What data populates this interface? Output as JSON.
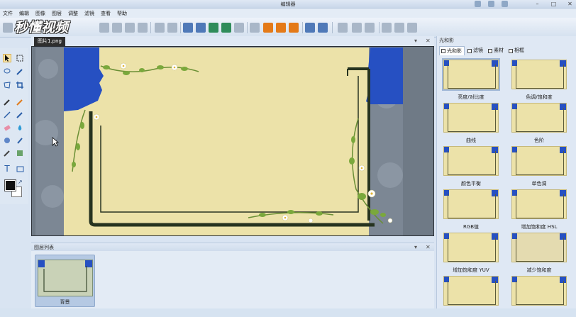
{
  "window": {
    "title": "编辑器"
  },
  "menu": [
    "文件",
    "编辑",
    "图像",
    "图层",
    "调整",
    "滤镜",
    "查看",
    "帮助"
  ],
  "watermark": "秒懂视频",
  "document": {
    "tab_title": "图片1.png"
  },
  "layers_panel": {
    "title": "图层列表",
    "layers": [
      {
        "name": "背景"
      }
    ]
  },
  "effects_panel": {
    "title": "光和影",
    "tabs": [
      {
        "label": "光和影",
        "active": true
      },
      {
        "label": "滤镜",
        "active": false
      },
      {
        "label": "素材",
        "active": false
      },
      {
        "label": "相框",
        "active": false
      }
    ],
    "effects": [
      {
        "label": "亮度/对比度"
      },
      {
        "label": "色调/饱和度"
      },
      {
        "label": "曲线"
      },
      {
        "label": "色阶"
      },
      {
        "label": "颜色平衡"
      },
      {
        "label": "单色调"
      },
      {
        "label": "RGB值"
      },
      {
        "label": "增加饱和度 HSL"
      },
      {
        "label": "增加饱和度 YUV"
      },
      {
        "label": "减少饱和度"
      },
      {
        "label": ""
      },
      {
        "label": ""
      }
    ]
  },
  "colors": {
    "accent_blue": "#2650c2",
    "image_background": "#ece2a9",
    "foreground_color": "#111111",
    "background_color": "#ffffff"
  }
}
